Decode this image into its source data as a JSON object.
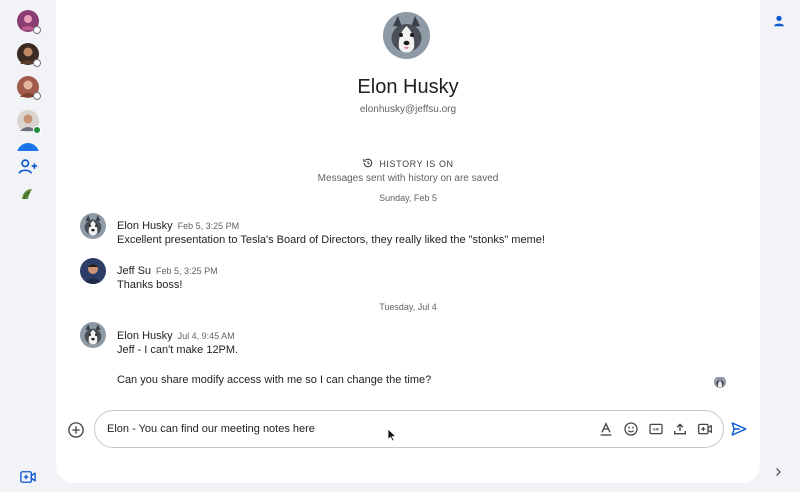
{
  "left_rail": {
    "avatars": [
      {
        "status": "away"
      },
      {
        "status": "away"
      },
      {
        "status": "away"
      },
      {
        "status": "online"
      }
    ]
  },
  "contact": {
    "name": "Elon Husky",
    "email": "elonhusky@jeffsu.org"
  },
  "history": {
    "label": "HISTORY IS ON",
    "sub": "Messages sent with history on are saved"
  },
  "conversation": {
    "date_1": "Sunday, Feb 5",
    "date_2": "Tuesday, Jul 4",
    "messages": [
      {
        "sender": "Elon Husky",
        "time": "Feb 5, 3:25 PM",
        "text": "Excellent presentation to Tesla's Board of Directors, they really liked the \"stonks\" meme!"
      },
      {
        "sender": "Jeff Su",
        "time": "Feb 5, 3:25 PM",
        "text": "Thanks boss!"
      },
      {
        "sender": "Elon Husky",
        "time": "Jul 4, 9:45 AM",
        "text": "Jeff - I can't make 12PM.",
        "text_2": "Can you share modify access with me so I can change the time?"
      }
    ]
  },
  "composer": {
    "value": "Elon - You can find our meeting notes here",
    "tools": [
      "format-text-icon",
      "emoji-icon",
      "gif-icon",
      "upload-icon",
      "video-meeting-icon"
    ]
  },
  "colors": {
    "accent": "#0b57d0",
    "online": "#1e8e3e",
    "background": "#f1f3f6"
  }
}
